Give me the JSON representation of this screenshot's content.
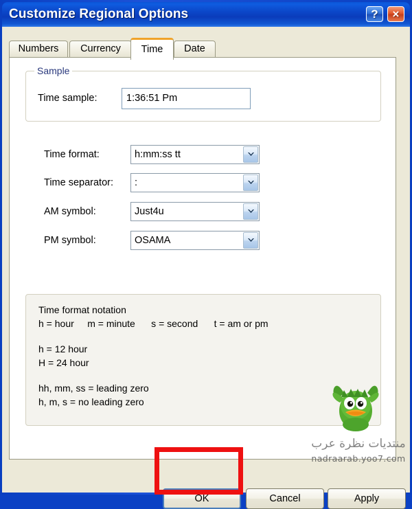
{
  "window": {
    "title": "Customize Regional Options",
    "help_button": "?",
    "close_button": "×"
  },
  "tabs": [
    {
      "label": "Numbers",
      "active": false
    },
    {
      "label": "Currency",
      "active": false
    },
    {
      "label": "Time",
      "active": true
    },
    {
      "label": "Date",
      "active": false
    }
  ],
  "sample_group": {
    "legend": "Sample",
    "time_sample_label": "Time sample:",
    "time_sample_value": "1:36:51 Pm"
  },
  "fields": [
    {
      "label": "Time format:",
      "value": "h:mm:ss tt"
    },
    {
      "label": "Time separator:",
      "value": ":"
    },
    {
      "label": "AM symbol:",
      "value": "Just4u"
    },
    {
      "label": "PM symbol:",
      "value": "OSAMA"
    }
  ],
  "notation": {
    "heading": "Time format notation",
    "line_tokens": "h = hour     m = minute      s = second      t = am or pm",
    "line_12": "h = 12 hour",
    "line_24": "H = 24 hour",
    "line_leading": "hh, mm, ss = leading zero",
    "line_noleading": "h, m, s = no leading zero"
  },
  "watermark": {
    "arabic": "منتديات نظرة عرب",
    "url": "nadraarab.yoo7.com"
  },
  "footer": {
    "ok": "OK",
    "cancel": "Cancel",
    "apply": "Apply"
  },
  "colors": {
    "title_bar_blue": "#0b46c8",
    "dialog_face": "#ece9d8",
    "active_tab_top": "#f0a32a",
    "group_legend_blue": "#29387c",
    "highlight_red": "#ee1111",
    "default_button_border": "#4a7ebb"
  }
}
